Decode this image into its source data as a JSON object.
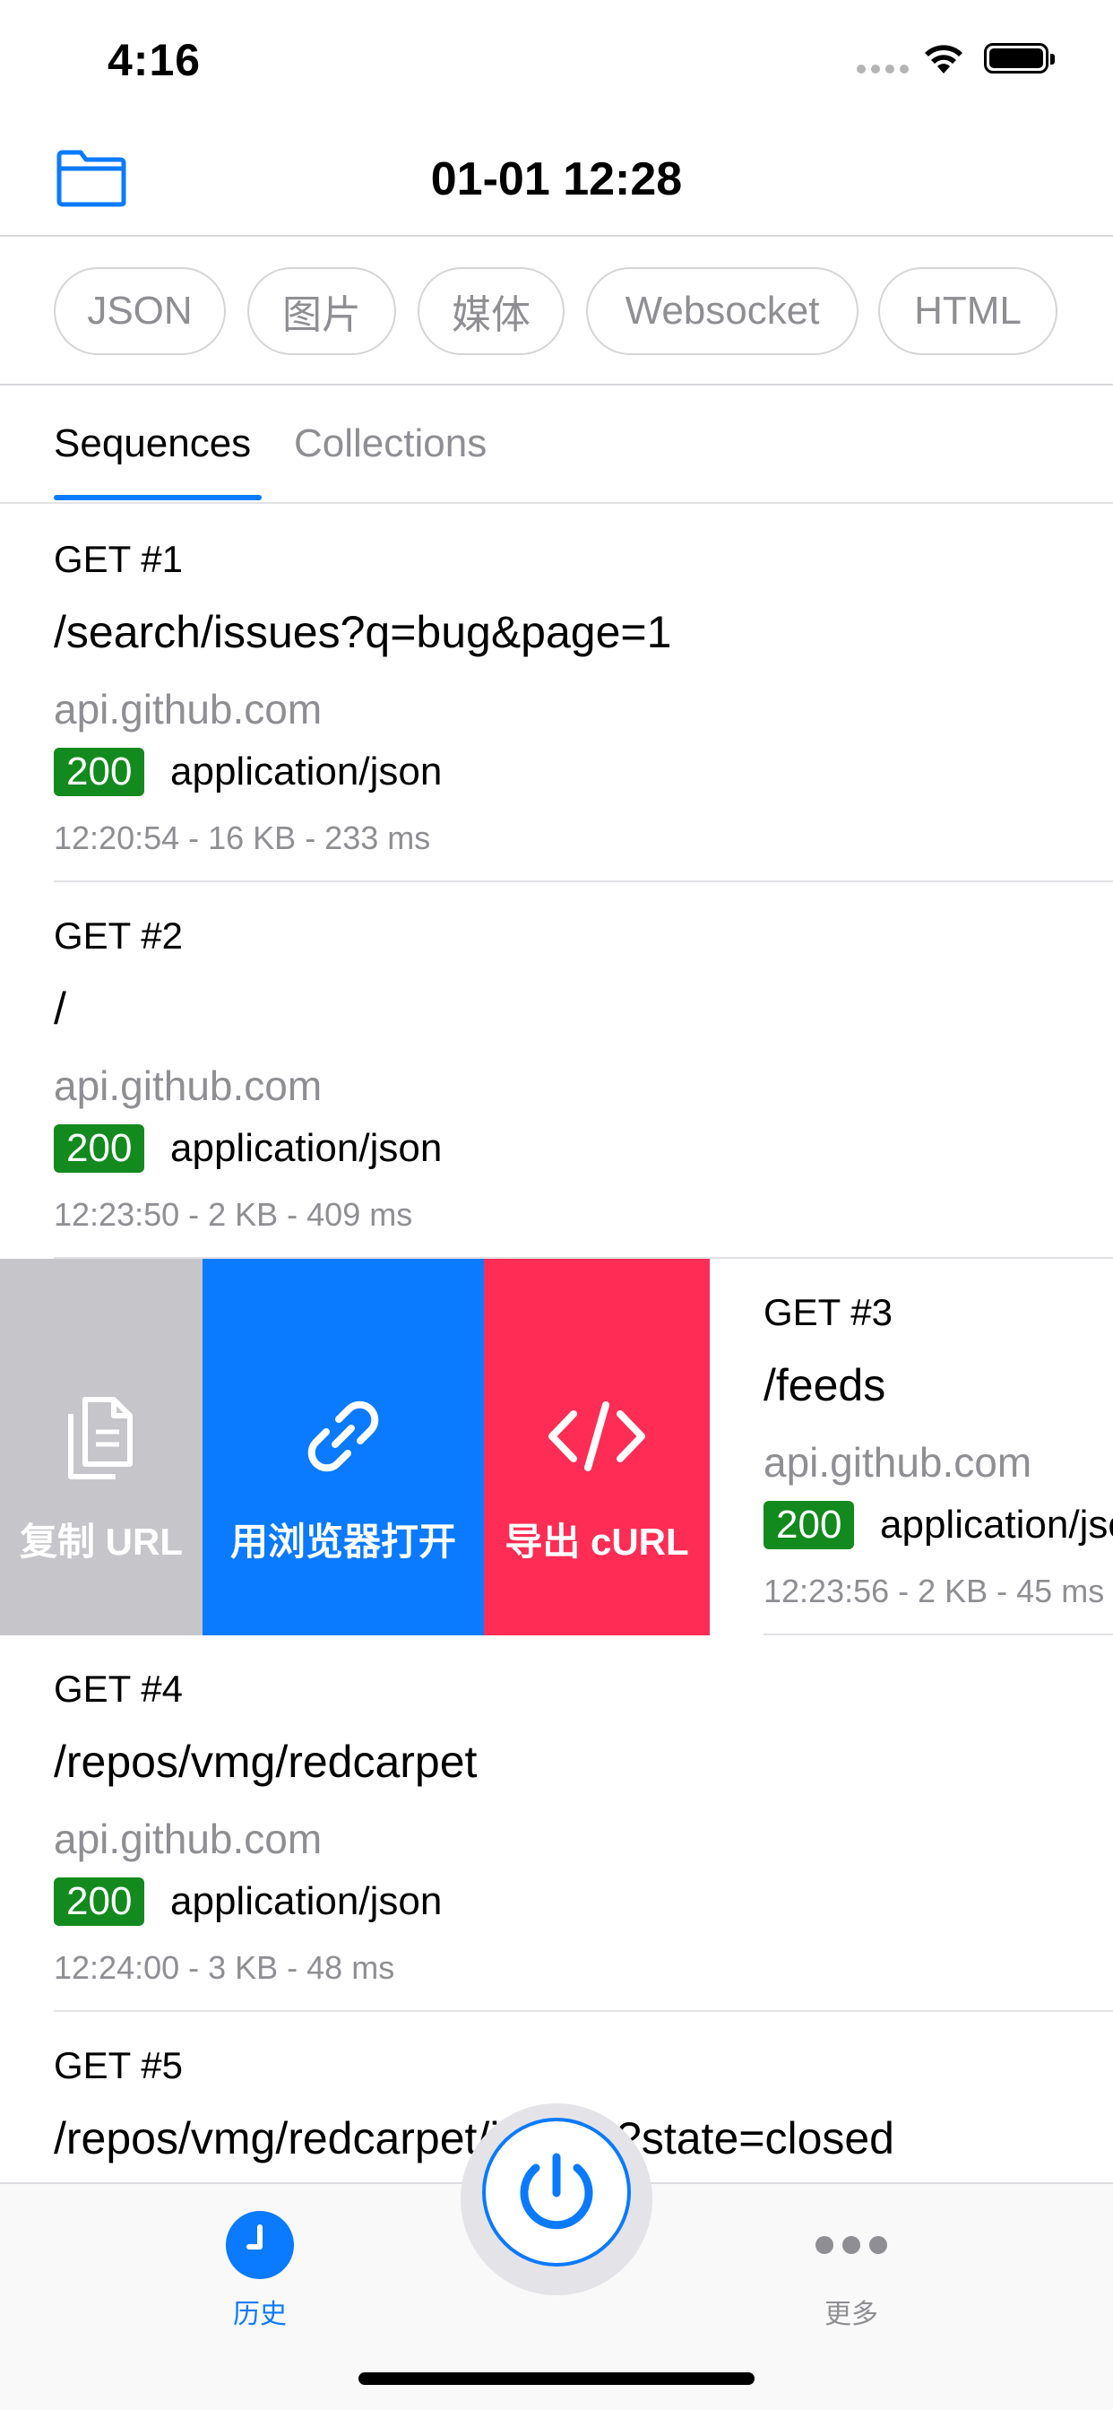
{
  "status_bar": {
    "time": "4:16"
  },
  "nav": {
    "title": "01-01 12:28",
    "folder_icon": "folder-icon"
  },
  "filters": [
    "JSON",
    "图片",
    "媒体",
    "Websocket",
    "HTML"
  ],
  "tabs": {
    "sequences": "Sequences",
    "collections": "Collections"
  },
  "requests": [
    {
      "method": "GET  #1",
      "path": "/search/issues?q=bug&page=1",
      "host": "api.github.com",
      "status": "200",
      "content_type": "application/json",
      "meta": "12:20:54 - 16 KB - 233 ms"
    },
    {
      "method": "GET  #2",
      "path": "/",
      "host": "api.github.com",
      "status": "200",
      "content_type": "application/json",
      "meta": "12:23:50 - 2 KB - 409 ms"
    },
    {
      "method": "GET  #3",
      "path": "/feeds",
      "host": "api.github.com",
      "status": "200",
      "content_type": "application/json",
      "meta": "12:23:56 - 2 KB - 45 ms"
    },
    {
      "method": "GET  #4",
      "path": "/repos/vmg/redcarpet",
      "host": "api.github.com",
      "status": "200",
      "content_type": "application/json",
      "meta": "12:24:00 - 3 KB - 48 ms"
    },
    {
      "method": "GET  #5",
      "path": "/repos/vmg/redcarpet/issues?state=closed"
    }
  ],
  "swipe_actions": {
    "copy_url": "复制 URL",
    "open_browser": "用浏览器打开",
    "export_curl": "导出 cURL"
  },
  "tab_bar": {
    "history": "历史",
    "more": "更多"
  },
  "colors": {
    "accent": "#0a7aff",
    "status_ok": "#138a1e",
    "copy_bg": "#c6c6ca",
    "export_bg": "#ff2d55"
  }
}
